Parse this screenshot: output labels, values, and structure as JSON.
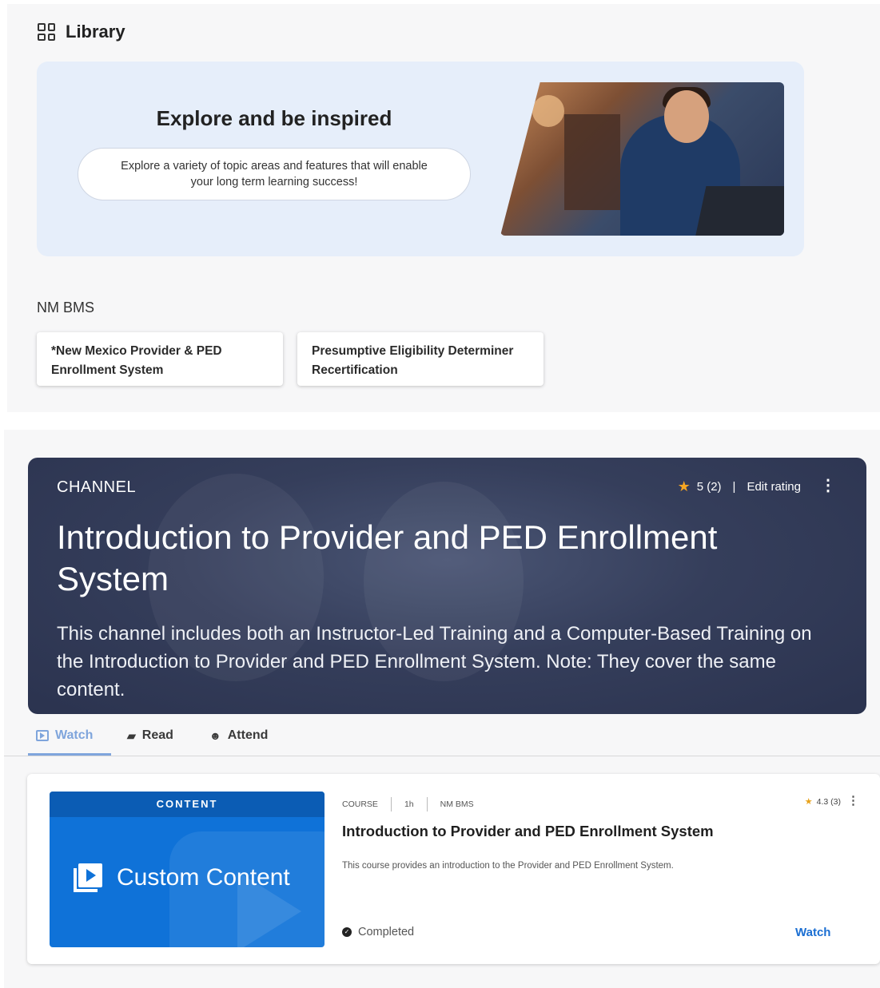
{
  "library": {
    "title": "Library",
    "icon": "grid-icon"
  },
  "hero": {
    "heading": "Explore and be inspired",
    "subtext": "Explore a variety of topic areas and features that will enable your long term learning success!"
  },
  "section": {
    "label": "NM BMS",
    "cards": [
      {
        "label": "*New Mexico Provider & PED Enrollment System"
      },
      {
        "label": "Presumptive Eligibility Determiner Recertification"
      }
    ]
  },
  "channel": {
    "kicker": "CHANNEL",
    "rating_value": "5 (2)",
    "separator": "|",
    "edit_rating": "Edit rating",
    "title": "Introduction to Provider and PED Enrollment System",
    "description": "This channel includes both an Instructor-Led Training and a Computer-Based Training on the Introduction to Provider and PED Enrollment System. Note: They cover the same content."
  },
  "tabs": [
    {
      "label": "Watch",
      "icon": "video-icon",
      "active": true
    },
    {
      "label": "Read",
      "icon": "book-icon",
      "active": false
    },
    {
      "label": "Attend",
      "icon": "person-speaking-icon",
      "active": false
    }
  ],
  "course": {
    "thumb_band": "CONTENT",
    "thumb_title": "Custom Content",
    "type": "COURSE",
    "duration": "1h",
    "provider": "NM BMS",
    "rating": "4.3 (3)",
    "title": "Introduction to Provider and PED Enrollment System",
    "description": "This course provides an introduction to the Provider and PED Enrollment System.",
    "status": "Completed",
    "action": "Watch"
  },
  "colors": {
    "accent": "#7fa5dc",
    "link": "#1a6ed2",
    "channel_bg": "#353e5b",
    "star": "#f5a623"
  }
}
